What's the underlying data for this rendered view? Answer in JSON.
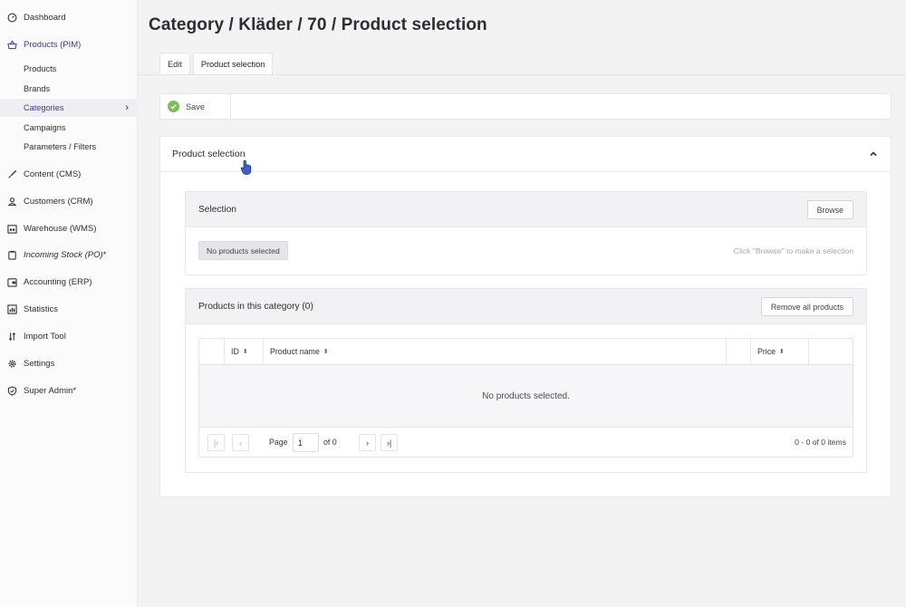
{
  "sidebar": {
    "dashboard": "Dashboard",
    "products_pim": "Products (PIM)",
    "products": "Products",
    "brands": "Brands",
    "categories": "Categories",
    "campaigns": "Campaigns",
    "parameters": "Parameters / Filters",
    "content_cms": "Content (CMS)",
    "customers_crm": "Customers (CRM)",
    "warehouse_wms": "Warehouse (WMS)",
    "incoming_stock": "Incoming Stock (PO)",
    "incoming_stock_mark": "*",
    "accounting_erp": "Accounting (ERP)",
    "statistics": "Statistics",
    "import_tool": "Import Tool",
    "settings": "Settings",
    "super_admin": "Super Admin",
    "super_admin_mark": "*"
  },
  "page": {
    "title": "Category / Kläder / 70 / Product selection"
  },
  "tabs": {
    "edit": "Edit",
    "product_selection": "Product selection"
  },
  "toolbar": {
    "save_label": "Save"
  },
  "panel": {
    "title": "Product selection"
  },
  "selection": {
    "title": "Selection",
    "browse_label": "Browse",
    "chip_label": "No products selected",
    "hint": "Click \"Browse\" to make a selection"
  },
  "category_products": {
    "title": "Products in this category (0)",
    "remove_all_label": "Remove all products",
    "columns": {
      "id": "ID",
      "product_name": "Product name",
      "price": "Price"
    },
    "empty_message": "No products selected.",
    "pager": {
      "page_label": "Page",
      "page_value": "1",
      "of_label": "of 0",
      "count": "0 - 0 of 0 items"
    }
  },
  "colors": {
    "accent": "#3b3a8a",
    "save_ok": "#7dbb5b"
  }
}
